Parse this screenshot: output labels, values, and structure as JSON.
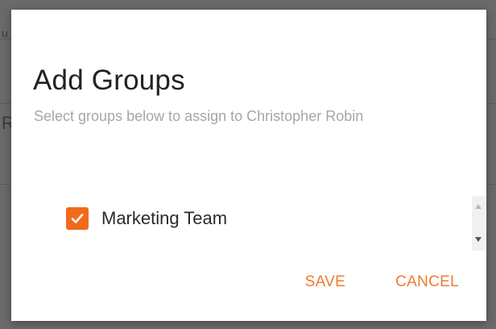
{
  "dialog": {
    "title": "Add Groups",
    "subtitle": "Select groups below to assign to Christopher Robin",
    "groups": [
      {
        "label": "Marketing Team",
        "checked": true
      }
    ],
    "actions": {
      "save_label": "SAVE",
      "cancel_label": "CANCEL"
    }
  },
  "background": {
    "fragments": [
      "u",
      "R"
    ]
  },
  "colors": {
    "accent": "#f06a1c",
    "button_text": "#f07b32",
    "subtitle": "#a6a6a6"
  }
}
